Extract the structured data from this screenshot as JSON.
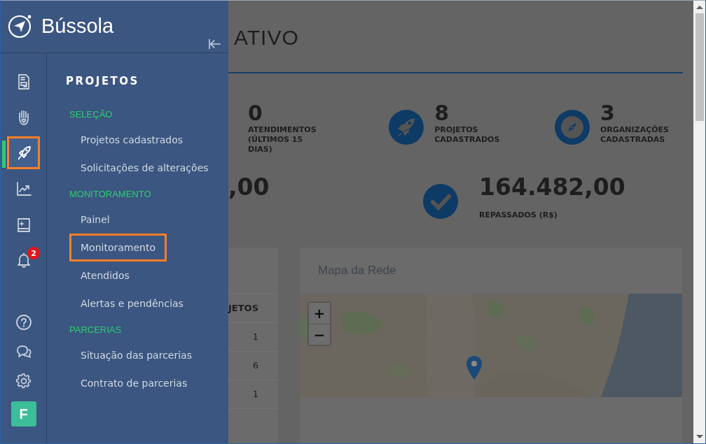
{
  "sidebar": {
    "brand": "Bússola",
    "rail": [
      {
        "kind": "document",
        "selected": false,
        "highlighted": false
      },
      {
        "kind": "hand",
        "selected": false,
        "highlighted": false
      },
      {
        "kind": "rocket",
        "selected": true,
        "highlighted": true
      },
      {
        "kind": "chart",
        "selected": false,
        "highlighted": false
      },
      {
        "kind": "book",
        "selected": false,
        "highlighted": false
      },
      {
        "kind": "bell",
        "selected": false,
        "highlighted": false,
        "badge": "2"
      }
    ],
    "rail_bottom": [
      {
        "kind": "help"
      },
      {
        "kind": "chat"
      },
      {
        "kind": "settings"
      }
    ],
    "avatar": "F",
    "menu": {
      "title": "PROJETOS",
      "sections": [
        {
          "heading": "SELEÇÃO",
          "items": [
            {
              "label": "Projetos cadastrados",
              "highlighted": false
            },
            {
              "label": "Solicitações de alterações",
              "highlighted": false
            }
          ]
        },
        {
          "heading": "MONITORAMENTO",
          "items": [
            {
              "label": "Painel",
              "highlighted": false
            },
            {
              "label": "Monitoramento",
              "highlighted": true
            },
            {
              "label": "Atendidos",
              "highlighted": false
            },
            {
              "label": "Alertas e pendências",
              "highlighted": false
            }
          ]
        },
        {
          "heading": "PARCERIAS",
          "items": [
            {
              "label": "Situação das parcerias",
              "highlighted": false
            },
            {
              "label": "Contrato de parcerias",
              "highlighted": false
            }
          ]
        }
      ]
    }
  },
  "main": {
    "title": "ATIVO",
    "stats": [
      {
        "value": "0",
        "label": "ATENDIMENTOS (ÚLTIMOS 15 DIAS)",
        "kind": "plain"
      },
      {
        "value": "8",
        "label": "PROJETOS CADASTRADOS",
        "kind": "rocket"
      },
      {
        "value": "3",
        "label": "ORGANIZAÇÕES CADASTRADAS",
        "kind": "compass"
      }
    ],
    "totals": [
      {
        "value": ",00",
        "kind": "plain"
      },
      {
        "value": "164.482,00",
        "label": "REPASSADOS (R$)",
        "kind": "check"
      }
    ],
    "table": {
      "column": "JETOS",
      "rows": [
        "1",
        "6",
        "1"
      ]
    },
    "map": {
      "title": "Mapa da Rede",
      "zoom_in": "+",
      "zoom_out": "−"
    }
  }
}
